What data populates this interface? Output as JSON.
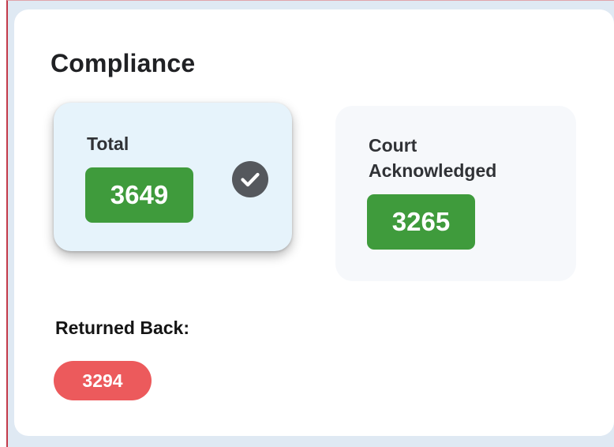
{
  "section": {
    "title": "Compliance"
  },
  "cards": {
    "total": {
      "label": "Total",
      "value": "3649",
      "selected_icon": "check-circle-icon"
    },
    "court": {
      "label_line1": "Court",
      "label_line2": "Acknowledged",
      "value": "3265"
    }
  },
  "returned": {
    "label": "Returned Back:",
    "value": "3294"
  },
  "colors": {
    "success": "#3f9b3c",
    "danger": "#ec5a5c",
    "selected_card_bg": "#e6f3fb"
  }
}
